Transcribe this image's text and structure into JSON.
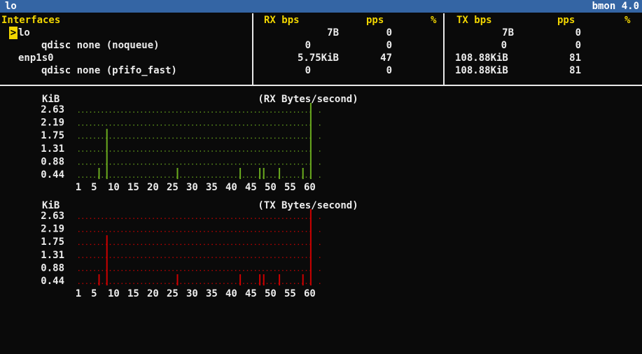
{
  "window": {
    "interface_name": "lo",
    "app_version": "bmon 4.0"
  },
  "table": {
    "headers": {
      "interfaces": "Interfaces",
      "rx_bps": "RX bps",
      "rx_pps": "pps",
      "rx_pct": "%",
      "tx_bps": "TX bps",
      "tx_pps": "pps",
      "tx_pct": "%"
    },
    "cursor_glyph": ">",
    "rows": [
      {
        "name": "lo",
        "rx_bps": "7B",
        "rx_pps": "0",
        "tx_bps": "7B",
        "tx_pps": "0"
      },
      {
        "name": "qdisc none (noqueue)",
        "rx_bps": "0",
        "rx_pps": "0",
        "tx_bps": "0",
        "tx_pps": "0"
      },
      {
        "name": "enp1s0",
        "rx_bps": "5.75KiB",
        "rx_pps": "47",
        "tx_bps": "108.88KiB",
        "tx_pps": "81"
      },
      {
        "name": "qdisc none (pfifo_fast)",
        "rx_bps": "0",
        "rx_pps": "0",
        "tx_bps": "108.88KiB",
        "tx_pps": "81"
      }
    ]
  },
  "colors": {
    "rx": "#6aaa1e",
    "tx": "#cc0000",
    "accent": "#f2d600",
    "title_bar": "#3465a4"
  },
  "chart_data": [
    {
      "type": "bar",
      "title": "(RX Bytes/second)",
      "ylabel": "KiB",
      "y_ticks": [
        "2.63",
        "2.19",
        "1.75",
        "1.31",
        "0.88",
        "0.44"
      ],
      "x_ticks": [
        "1",
        "5",
        "10",
        "15",
        "20",
        "25",
        "30",
        "35",
        "40",
        "45",
        "50",
        "55",
        "60"
      ],
      "x_tick_values": [
        1,
        5,
        10,
        15,
        20,
        25,
        30,
        35,
        40,
        45,
        50,
        55,
        60
      ],
      "points": [
        {
          "x": 6,
          "y": 0.44
        },
        {
          "x": 8,
          "y": 1.75
        },
        {
          "x": 26,
          "y": 0.44
        },
        {
          "x": 42,
          "y": 0.44
        },
        {
          "x": 47,
          "y": 0.44
        },
        {
          "x": 48,
          "y": 0.44
        },
        {
          "x": 52,
          "y": 0.44
        },
        {
          "x": 58,
          "y": 0.44
        },
        {
          "x": 60,
          "y": 2.63
        }
      ]
    },
    {
      "type": "bar",
      "title": "(TX Bytes/second)",
      "ylabel": "KiB",
      "y_ticks": [
        "2.63",
        "2.19",
        "1.75",
        "1.31",
        "0.88",
        "0.44"
      ],
      "x_ticks": [
        "1",
        "5",
        "10",
        "15",
        "20",
        "25",
        "30",
        "35",
        "40",
        "45",
        "50",
        "55",
        "60"
      ],
      "x_tick_values": [
        1,
        5,
        10,
        15,
        20,
        25,
        30,
        35,
        40,
        45,
        50,
        55,
        60
      ],
      "points": [
        {
          "x": 6,
          "y": 0.44
        },
        {
          "x": 8,
          "y": 1.75
        },
        {
          "x": 26,
          "y": 0.44
        },
        {
          "x": 42,
          "y": 0.44
        },
        {
          "x": 47,
          "y": 0.44
        },
        {
          "x": 48,
          "y": 0.44
        },
        {
          "x": 52,
          "y": 0.44
        },
        {
          "x": 58,
          "y": 0.44
        },
        {
          "x": 60,
          "y": 2.63
        }
      ]
    }
  ]
}
